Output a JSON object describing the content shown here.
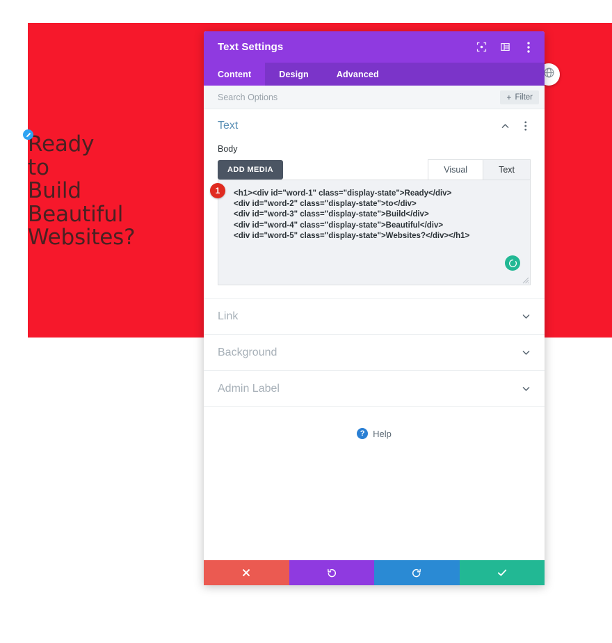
{
  "canvas": {
    "hero": {
      "background_color": "#f6182b",
      "text_color": "#4a2122",
      "edit_badge_icon": "pencil-icon",
      "heading_words": [
        "Ready",
        "to",
        "Build",
        "Beautiful",
        "Websites?"
      ]
    },
    "page_settings_button_icon": "globe-icon"
  },
  "modal": {
    "title": "Text Settings",
    "titlebar": {
      "background_color": "#8f3ae0",
      "icons": [
        "fullscreen-icon",
        "layout-columns-icon",
        "more-vertical-icon"
      ]
    },
    "tabs": [
      {
        "label": "Content",
        "active": true
      },
      {
        "label": "Design",
        "active": false
      },
      {
        "label": "Advanced",
        "active": false
      }
    ],
    "search": {
      "placeholder": "Search Options",
      "value": "",
      "filter_label": "Filter",
      "filter_plus": "+"
    },
    "text_group": {
      "title": "Text",
      "collapse_icon": "chevron-up-icon",
      "menu_icon": "more-vertical-icon",
      "field_label": "Body",
      "add_media_label": "ADD MEDIA",
      "mode_tabs": [
        {
          "label": "Visual",
          "active": false
        },
        {
          "label": "Text",
          "active": true
        }
      ],
      "badge_number": "1",
      "spinner_icon": "loading-spinner-icon",
      "resize_handle_icon": "resize-handle-icon",
      "code": "<h1><div id=\"word-1\" class=\"display-state\">Ready</div>\n<div id=\"word-2\" class=\"display-state\">to</div>\n<div id=\"word-3\" class=\"display-state\">Build</div>\n<div id=\"word-4\" class=\"display-state\">Beautiful</div>\n<div id=\"word-5\" class=\"display-state\">Websites?</div></h1>"
    },
    "collapsed_groups": [
      {
        "title": "Link",
        "chevron": "chevron-down-icon"
      },
      {
        "title": "Background",
        "chevron": "chevron-down-icon"
      },
      {
        "title": "Admin Label",
        "chevron": "chevron-down-icon"
      }
    ],
    "help": {
      "icon": "question-mark-icon",
      "icon_glyph": "?",
      "label": "Help"
    },
    "footer_buttons": [
      {
        "name": "cancel",
        "icon": "close-x-icon",
        "color": "#eb5a51"
      },
      {
        "name": "undo",
        "icon": "undo-arrow-icon",
        "color": "#8f3ae0"
      },
      {
        "name": "redo",
        "icon": "redo-arrow-icon",
        "color": "#2a8ad4"
      },
      {
        "name": "save",
        "icon": "checkmark-icon",
        "color": "#22b894"
      }
    ]
  }
}
